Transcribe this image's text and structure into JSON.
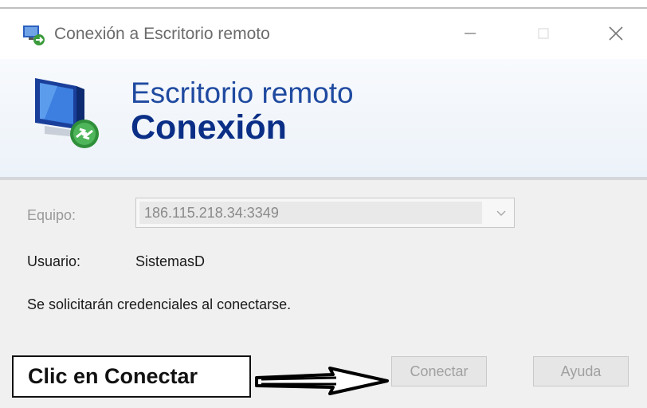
{
  "window": {
    "title": "Conexión a Escritorio remoto",
    "controls": [
      "minimize",
      "maximize",
      "close"
    ]
  },
  "banner": {
    "line1": "Escritorio remoto",
    "line2": "Conexión"
  },
  "form": {
    "computer_label": "Equipo:",
    "computer_value": "186.115.218.34:3349",
    "user_label": "Usuario:",
    "user_value": "SistemasD",
    "note": "Se solicitarán credenciales al conectarse."
  },
  "buttons": {
    "connect": "Conectar",
    "help": "Ayuda"
  },
  "annotation": {
    "text": "Clic en Conectar"
  },
  "icons": {
    "app": "remote-desktop-icon",
    "banner": "remote-desktop-monitor-icon",
    "dropdown": "chevron-down-icon"
  },
  "colors": {
    "banner_text": "#1f4aa0",
    "banner_bold": "#0b2f86",
    "disabled_text": "#9a9a9a"
  }
}
